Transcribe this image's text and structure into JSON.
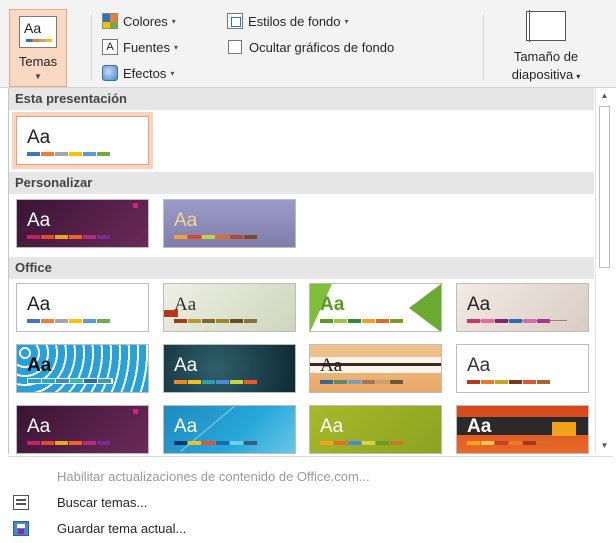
{
  "ribbon": {
    "themes_label": "Temas",
    "themes_icon_text": "Aa",
    "colors_label": "Colores",
    "fonts_label": "Fuentes",
    "fonts_icon_text": "A",
    "effects_label": "Efectos",
    "bg_styles_label": "Estilos de fondo",
    "hide_bg_label": "Ocultar gráficos de fondo",
    "slide_size_line1": "Tamaño de",
    "slide_size_line2": "diapositiva",
    "dropdown_glyph": "▾"
  },
  "gallery": {
    "sections": [
      {
        "title": "Esta presentación"
      },
      {
        "title": "Personalizar"
      },
      {
        "title": "Office"
      }
    ],
    "thumb_text": "Aa"
  },
  "menu": {
    "enable_updates": "Habilitar actualizaciones de contenido de Office.com...",
    "browse_themes": "Buscar temas...",
    "save_theme": "Guardar tema actual..."
  },
  "colors": {
    "selected_bg": "#f9d9c4",
    "section_bg": "#e6e6e6",
    "accent_blue": "#2e75b6"
  }
}
